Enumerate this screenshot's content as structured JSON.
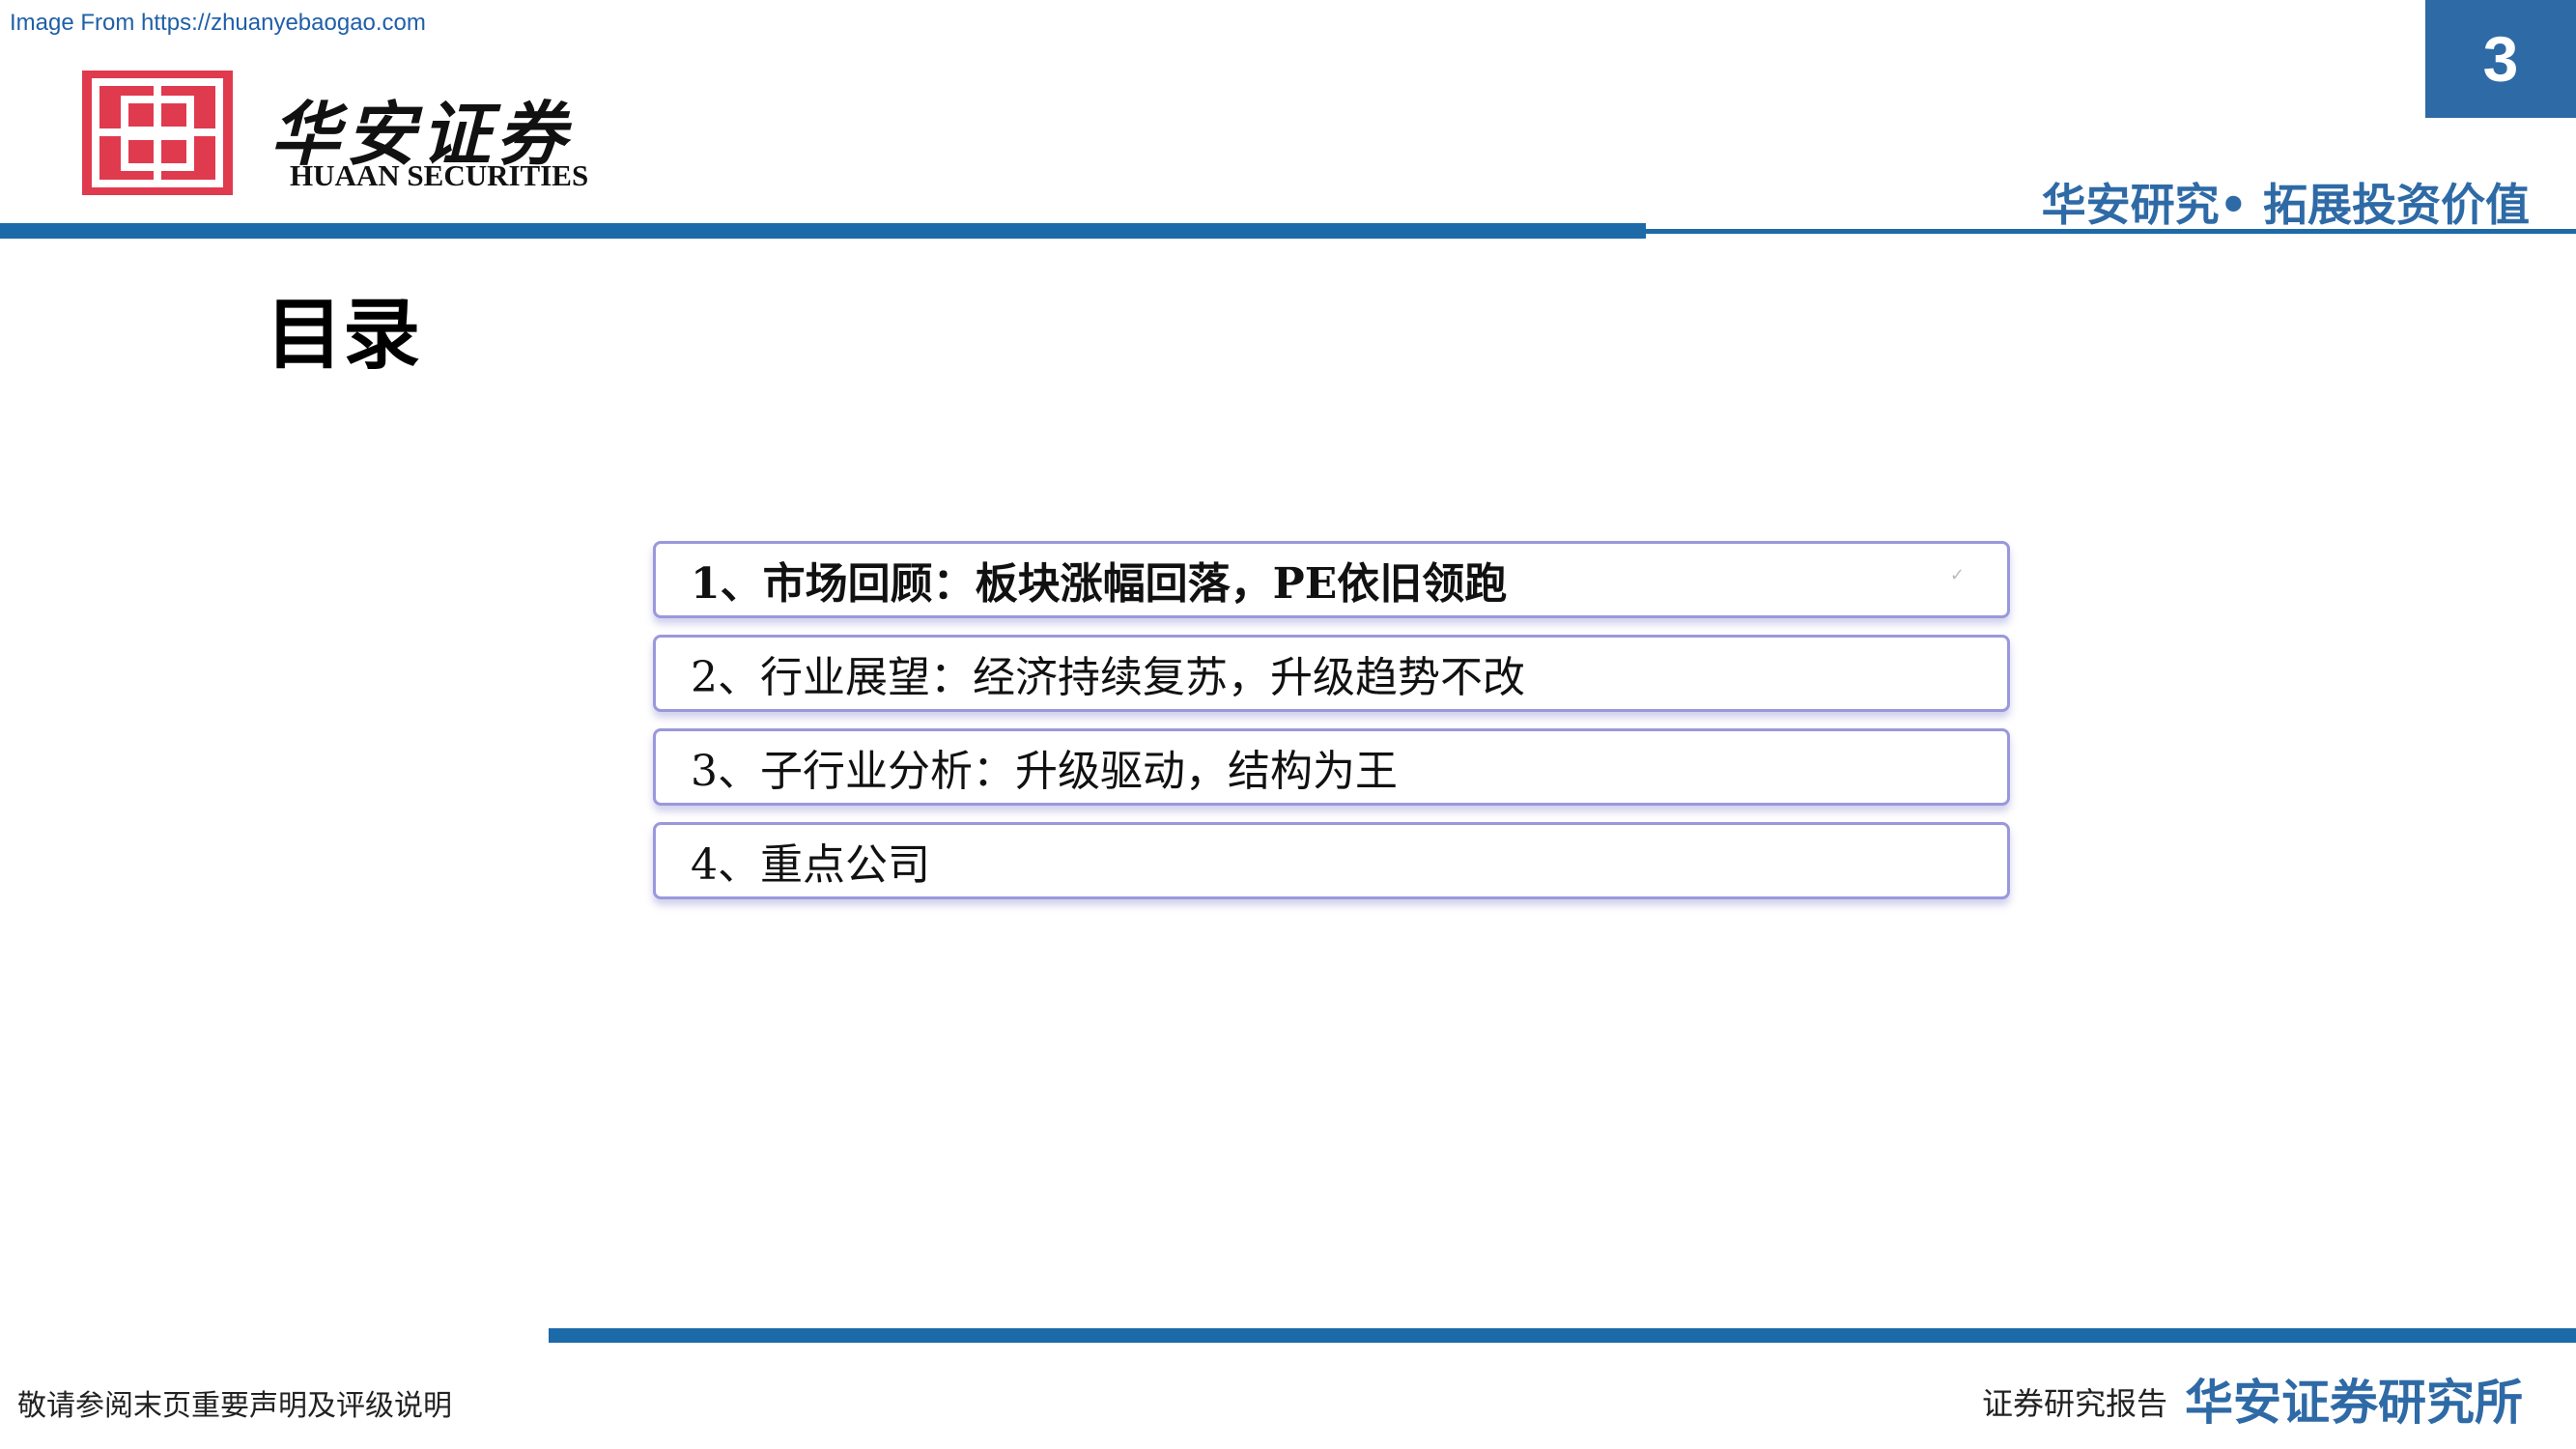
{
  "watermark": "Image From https://zhuanyebaogao.com",
  "logo": {
    "icon": "huaan-logo-icon",
    "cn_name": "华安证券",
    "en_name": "HUAAN SECURITIES",
    "colors": {
      "mark": "#e03a4f"
    }
  },
  "page_number": "3",
  "tagline": "华安研究• 拓展投资价值",
  "title": "目录",
  "toc": {
    "items": [
      {
        "label": "1、市场回顾：板块涨幅回落，PE依旧领跑",
        "active": true
      },
      {
        "label": "2、行业展望：经济持续复苏，升级趋势不改",
        "active": false
      },
      {
        "label": "3、子行业分析：升级驱动，结构为王",
        "active": false
      },
      {
        "label": "4、重点公司",
        "active": false
      }
    ],
    "check_mark": "✓"
  },
  "footer": {
    "disclaimer": "敬请参阅末页重要声明及评级说明",
    "report_type": "证券研究报告",
    "institute": "华安证券研究所"
  },
  "colors": {
    "brand_blue": "#1d6aa9",
    "accent_blue": "#2e6aa6",
    "toc_border": "#9a98dc"
  }
}
